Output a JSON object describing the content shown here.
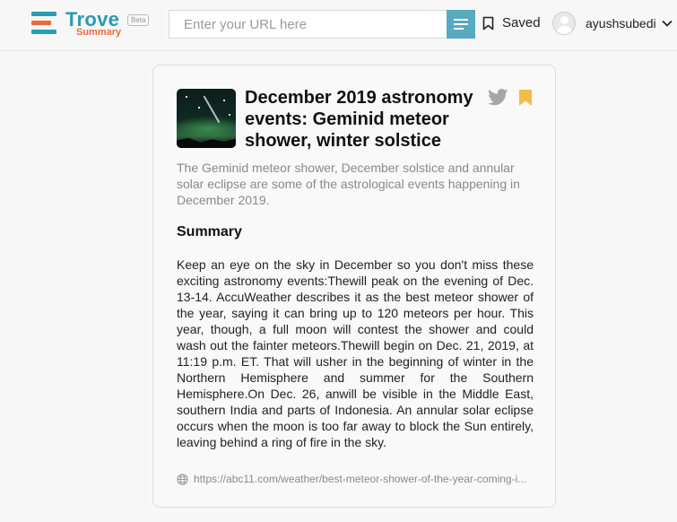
{
  "header": {
    "logo": {
      "title": "Trove",
      "subtitle": "Summary",
      "badge": "Beta"
    },
    "search": {
      "placeholder": "Enter your URL here",
      "value": ""
    },
    "saved_label": "Saved",
    "username": "ayushsubedi"
  },
  "article": {
    "title": "December 2019 astronomy events: Geminid meteor shower, winter solstice",
    "description": "The Geminid meteor shower, December solstice and annular solar eclipse are some of the astrological events happening in December 2019.",
    "summary_heading": "Summary",
    "summary": "Keep an eye on the sky in December so you don't miss these exciting astronomy events:Thewill peak on the evening of Dec. 13-14. AccuWeather describes it as the best meteor shower of the year, saying it can bring up to 120 meteors per hour. This year, though, a full moon will contest the shower and could wash out the fainter meteors.Thewill begin on Dec. 21, 2019, at 11:19 p.m. ET. That will usher in the beginning of winter in the Northern Hemisphere and summer for the Southern Hemisphere.On Dec. 26, anwill be visible in the Middle East, southern India and parts of Indonesia. An annular solar eclipse occurs when the moon is too far away to block the Sun entirely, leaving behind a ring of fire in the sky.",
    "source_url": "https://abc11.com/weather/best-meteor-shower-of-the-year-coming-i...",
    "bookmarked": true
  },
  "colors": {
    "brand_teal": "#2a9bb5",
    "brand_orange": "#f0693a",
    "search_button": "#5aa8c1",
    "bookmark": "#f6b94a",
    "twitter_icon": "#a6a6a6"
  },
  "icons": [
    "menu-icon",
    "bookmark-outline-icon",
    "avatar-icon",
    "chevron-down-icon",
    "twitter-icon",
    "bookmark-icon",
    "globe-icon"
  ]
}
